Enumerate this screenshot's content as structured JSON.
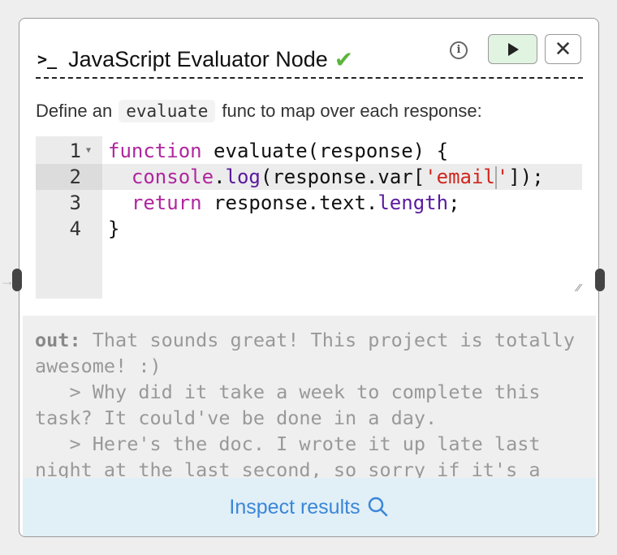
{
  "node": {
    "title": "JavaScript Evaluator Node",
    "status_icon": "check-icon",
    "accent_color": "#5bb53b",
    "terminal_icon": ">_",
    "info_icon": "i",
    "close_label": "✕",
    "description_prefix": "Define an",
    "description_keyword": "evaluate",
    "description_suffix": "func to map over each response:"
  },
  "editor": {
    "line_numbers": [
      "1",
      "2",
      "3",
      "4"
    ],
    "lines": [
      "function evaluate(response) {",
      "  console.log(response.var['email']);",
      "  return response.text.length;",
      "}"
    ],
    "active_line": 2
  },
  "output": {
    "label": "out:",
    "text": " That sounds great! This project is totally awesome! :)\n   > Why did it take a week to complete this task? It could've be done in a day.\n   > Here's the doc. I wrote it up late last night at the last second, so sorry if it's a"
  },
  "inspect": {
    "label": "Inspect results",
    "icon": "search-icon",
    "color": "#3a86d8"
  }
}
